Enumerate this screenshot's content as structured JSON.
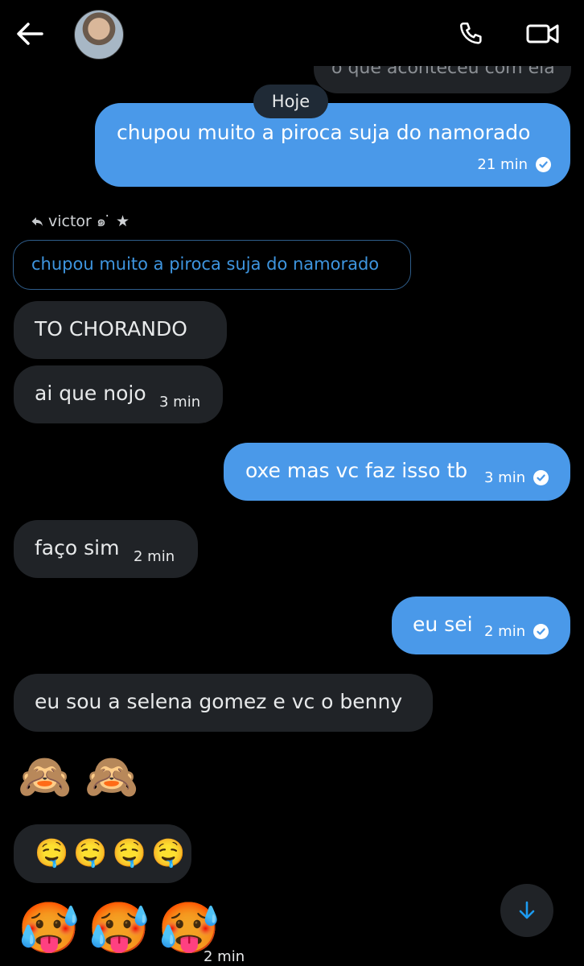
{
  "header": {
    "back_icon": "arrow-left-icon",
    "call_icon": "phone-icon",
    "video_icon": "video-camera-icon"
  },
  "previous_reply_snippet": "o que aconteceu com ela",
  "date_divider": "Hoje",
  "messages": [
    {
      "type": "out",
      "text": "chupou muito a piroca suja do namorado",
      "time": "21 min",
      "read": true
    },
    {
      "type": "reply_label",
      "text": "victor ๑ ̇ ★"
    },
    {
      "type": "quote",
      "text": "chupou muito a piroca suja do namorado"
    },
    {
      "type": "in",
      "text": "TO CHORANDO"
    },
    {
      "type": "in",
      "text": "ai que nojo",
      "time": "3 min"
    },
    {
      "type": "out",
      "text": "oxe mas vc faz isso tb",
      "time": "3 min",
      "read": true
    },
    {
      "type": "in",
      "text": "faço sim",
      "time": "2 min"
    },
    {
      "type": "out",
      "text": "eu sei",
      "time": "2 min",
      "read": true
    },
    {
      "type": "in",
      "text": "eu sou a selena gomez e vc o benny"
    },
    {
      "type": "emoji",
      "text": "🙈🙈"
    },
    {
      "type": "emoji_bubble",
      "text": "🤤🤤🤤🤤"
    },
    {
      "type": "emoji",
      "text": "🥵🥵🥵",
      "time": "2 min"
    }
  ],
  "scroll_down_icon": "arrow-down-icon",
  "colors": {
    "background": "#000000",
    "outgoing_bubble": "#4a99e9",
    "incoming_bubble": "#202327",
    "accent": "#1d9bf0"
  }
}
